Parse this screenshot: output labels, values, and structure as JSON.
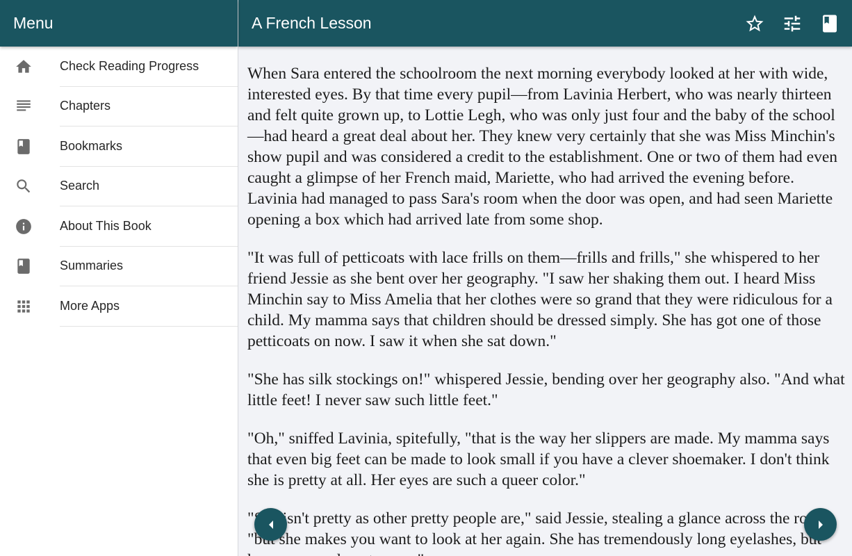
{
  "drawer": {
    "title": "Menu",
    "items": [
      {
        "label": "Check Reading Progress",
        "icon": "home-icon"
      },
      {
        "label": "Chapters",
        "icon": "list-icon"
      },
      {
        "label": "Bookmarks",
        "icon": "book-icon"
      },
      {
        "label": "Search",
        "icon": "search-icon"
      },
      {
        "label": "About This Book",
        "icon": "info-icon"
      },
      {
        "label": "Summaries",
        "icon": "book-icon"
      },
      {
        "label": "More Apps",
        "icon": "apps-grid-icon"
      }
    ]
  },
  "toolbar": {
    "title": "A French Lesson",
    "icons": [
      "star-outline-icon",
      "tune-sliders-icon",
      "book-icon"
    ]
  },
  "content": {
    "paragraphs": [
      "When Sara entered the schoolroom the next morning everybody looked at her with wide, interested eyes. By that time every pupil—from Lavinia Herbert, who was nearly thirteen and felt quite grown up, to Lottie Legh, who was only just four and the baby of the school—had heard a great deal about her. They knew very certainly that she was Miss Minchin's show pupil and was considered a credit to the establishment. One or two of them had even caught a glimpse of her French maid, Mariette, who had arrived the evening before. Lavinia had managed to pass Sara's room when the door was open, and had seen Mariette opening a box which had arrived late from some shop.",
      "\"It was full of petticoats with lace frills on them—frills and frills,\" she whispered to her friend Jessie as she bent over her geography. \"I saw her shaking them out. I heard Miss Minchin say to Miss Amelia that her clothes were so grand that they were ridiculous for a child. My mamma says that children should be dressed simply. She has got one of those petticoats on now. I saw it when she sat down.\"",
      "\"She has silk stockings on!\" whispered Jessie, bending over her geography also. \"And what little feet! I never saw such little feet.\"",
      "\"Oh,\" sniffed Lavinia, spitefully, \"that is the way her slippers are made. My mamma says that even big feet can be made to look small if you have a clever shoemaker. I don't think she is pretty at all. Her eyes are such a queer color.\"",
      "\"She isn't pretty as other pretty people are,\" said Jessie, stealing a glance across the room; \"but she makes you want to look at her again. She has tremendously long eyelashes, but her eyes are almost green.\""
    ]
  },
  "colors": {
    "primary": "#1a5560",
    "background": "#f2f3f7",
    "drawer_background": "#ffffff",
    "icon_gray": "#6b6b6b"
  },
  "nav": {
    "prev_icon": "chevron-left-icon",
    "next_icon": "chevron-right-icon"
  }
}
